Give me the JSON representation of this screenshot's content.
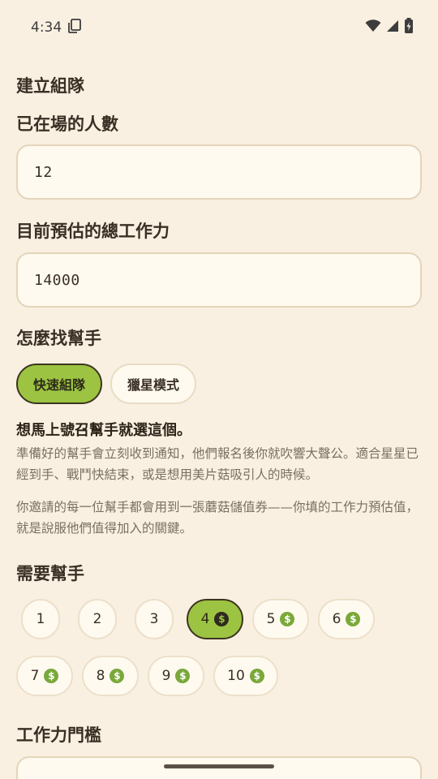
{
  "status_bar": {
    "time": "4:34"
  },
  "form": {
    "page_title": "建立組隊",
    "present_count": {
      "label": "已在場的人數",
      "value": "12"
    },
    "total_power": {
      "label": "目前預估的總工作力",
      "value": "14000"
    },
    "recruit_mode": {
      "label": "怎麼找幫手",
      "options": [
        "快速組隊",
        "獵星模式"
      ],
      "selected": "快速組隊",
      "headline": "想馬上號召幫手就選這個。",
      "description": "準備好的幫手會立刻收到通知，他們報名後你就吹響大聲公。適合星星已經到手、戰鬥快結束，或是想用美片菇吸引人的時候。",
      "note": "你邀請的每一位幫手都會用到一張蘑菇儲值券——你填的工作力預估值，就是說服他們值得加入的關鍵。"
    },
    "helpers_needed": {
      "label": "需要幫手",
      "options": [
        "1",
        "2",
        "3",
        "4",
        "5",
        "6",
        "7",
        "8",
        "9",
        "10"
      ],
      "selected": "4",
      "coin_symbol": "$"
    },
    "power_threshold": {
      "label": "工作力門檻"
    }
  },
  "colors": {
    "background": "#faf0e1",
    "accent": "#9cc442",
    "coin": "#7aa83a"
  }
}
